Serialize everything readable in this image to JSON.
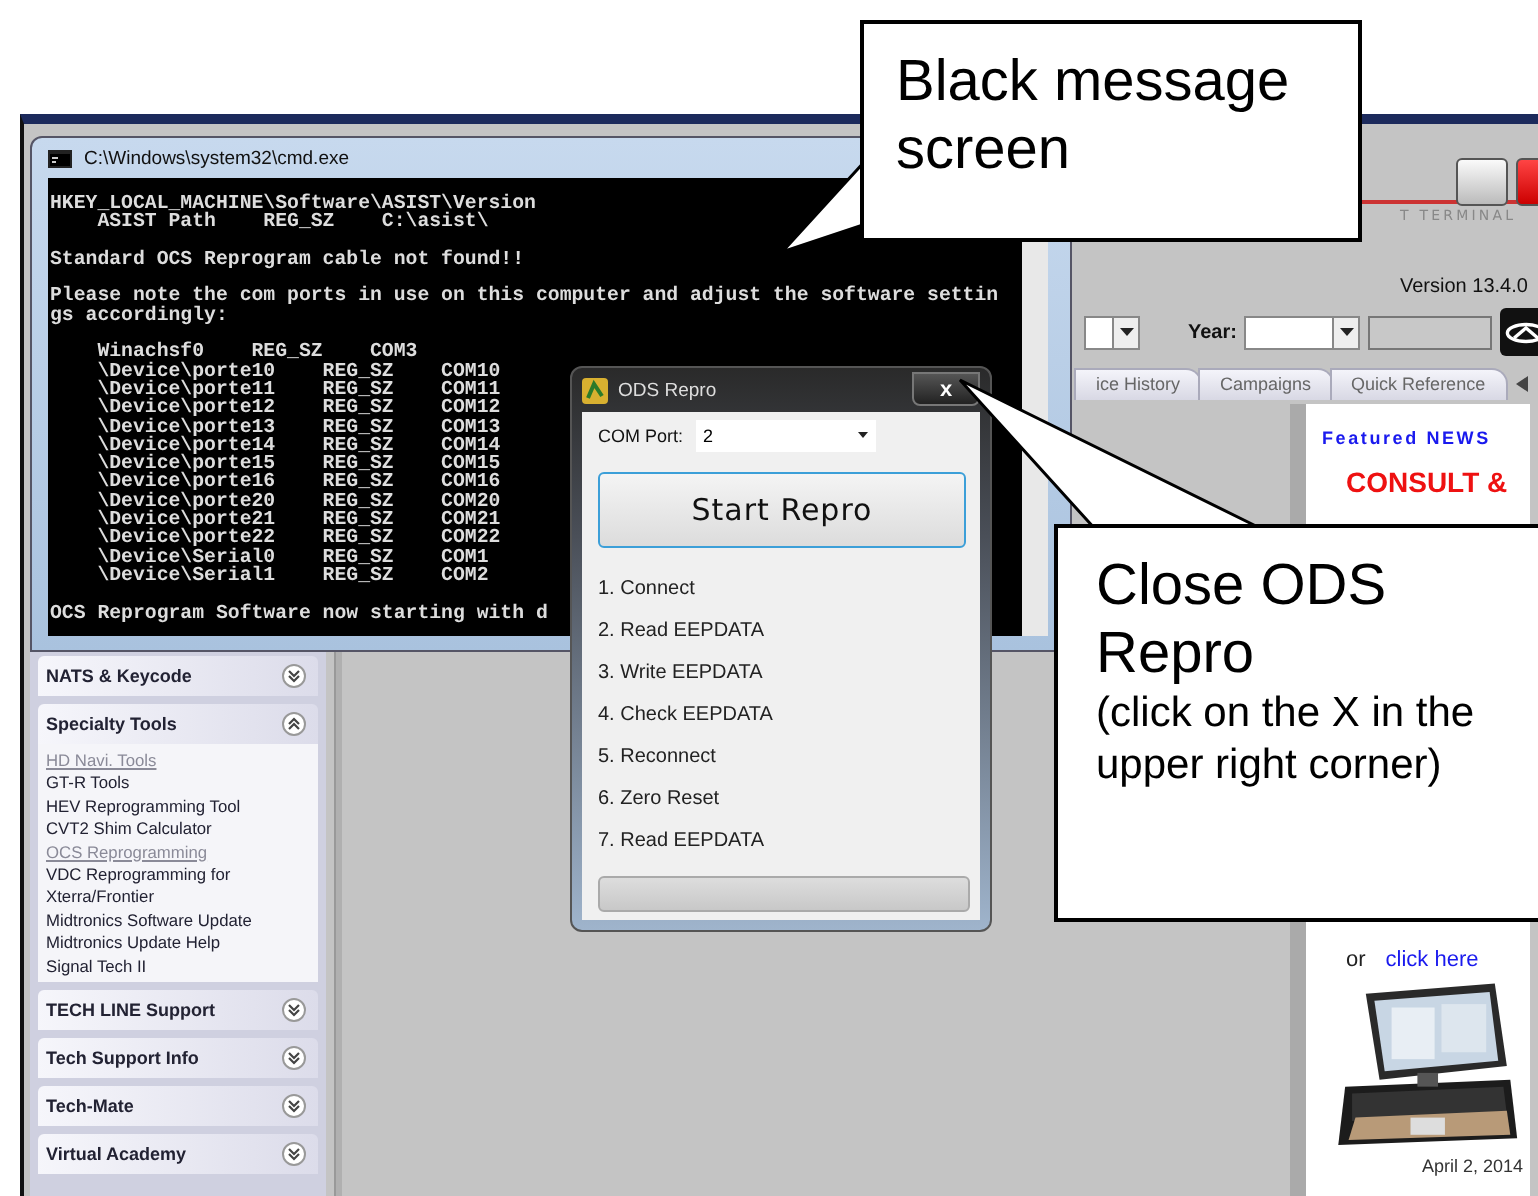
{
  "main_window": {
    "branding": "T TERMINAL",
    "version": "Version 13.4.0",
    "year_label": "Year:",
    "tabs": [
      {
        "label": "ice History",
        "selected": false
      },
      {
        "label": "Campaigns",
        "selected": false
      },
      {
        "label": "Quick Reference",
        "selected": false
      }
    ],
    "sidebar": [
      {
        "title": "NATS & Keycode",
        "expanded": false
      },
      {
        "title": "Specialty Tools",
        "expanded": true,
        "items": [
          {
            "label": "HD Navi. Tools",
            "visited": true
          },
          {
            "label": "GT-R Tools",
            "visited": false
          },
          {
            "label": "HEV Reprogramming Tool",
            "visited": false
          },
          {
            "label": "CVT2 Shim Calculator",
            "visited": false
          },
          {
            "label": "OCS Reprogramming",
            "visited": true
          },
          {
            "label": "VDC Reprogramming for Xterra/Frontier",
            "visited": false
          },
          {
            "label": "Midtronics Software Update",
            "visited": false
          },
          {
            "label": "Midtronics Update Help",
            "visited": false
          },
          {
            "label": "Signal Tech II",
            "visited": false
          }
        ]
      },
      {
        "title": "TECH LINE Support",
        "expanded": false
      },
      {
        "title": "Tech Support Info",
        "expanded": false
      },
      {
        "title": "Tech-Mate",
        "expanded": false
      },
      {
        "title": "Virtual Academy",
        "expanded": false
      }
    ],
    "news": {
      "heading": "Featured NEWS",
      "headline": [
        "CONSULT &"
      ],
      "link_prefix": "or",
      "link": "click here",
      "date": "April 2, 2014"
    }
  },
  "console_window": {
    "title": "C:\\Windows\\system32\\cmd.exe",
    "blocks": [
      [
        "HKEY_LOCAL_MACHINE\\Software\\ASIST\\Version",
        "    ASIST Path    REG_SZ    C:\\asist\\"
      ],
      [
        "Standard OCS Reprogram cable not found!!"
      ],
      [
        "Please note the com ports in use on this computer and adjust the software settin",
        "gs accordingly:"
      ],
      [
        "    Winachsf0    REG_SZ    COM3",
        "    \\Device\\porte10    REG_SZ    COM10",
        "    \\Device\\porte11    REG_SZ    COM11",
        "    \\Device\\porte12    REG_SZ    COM12",
        "    \\Device\\porte13    REG_SZ    COM13",
        "    \\Device\\porte14    REG_SZ    COM14",
        "    \\Device\\porte15    REG_SZ    COM15",
        "    \\Device\\porte16    REG_SZ    COM16",
        "    \\Device\\porte20    REG_SZ    COM20",
        "    \\Device\\porte21    REG_SZ    COM21",
        "    \\Device\\porte22    REG_SZ    COM22",
        "    \\Device\\Serial0    REG_SZ    COM1",
        "    \\Device\\Serial1    REG_SZ    COM2"
      ],
      [
        "OCS Reprogram Software now starting with d"
      ]
    ]
  },
  "dialog": {
    "title": "ODS Repro",
    "close": "x",
    "com_port_label": "COM Port:",
    "com_port_value": "2",
    "start_button": "Start Repro",
    "steps": [
      "1. Connect",
      "2. Read EEPDATA",
      "3. Write EEPDATA",
      "4. Check EEPDATA",
      "5. Reconnect",
      "6. Zero Reset",
      "7. Read EEPDATA"
    ],
    "progress": {
      "level": 0
    }
  },
  "callouts": [
    {
      "title": "Black message screen"
    },
    {
      "title": "Close ODS Repro",
      "note": "(click on the X in the upper right corner)"
    }
  ]
}
